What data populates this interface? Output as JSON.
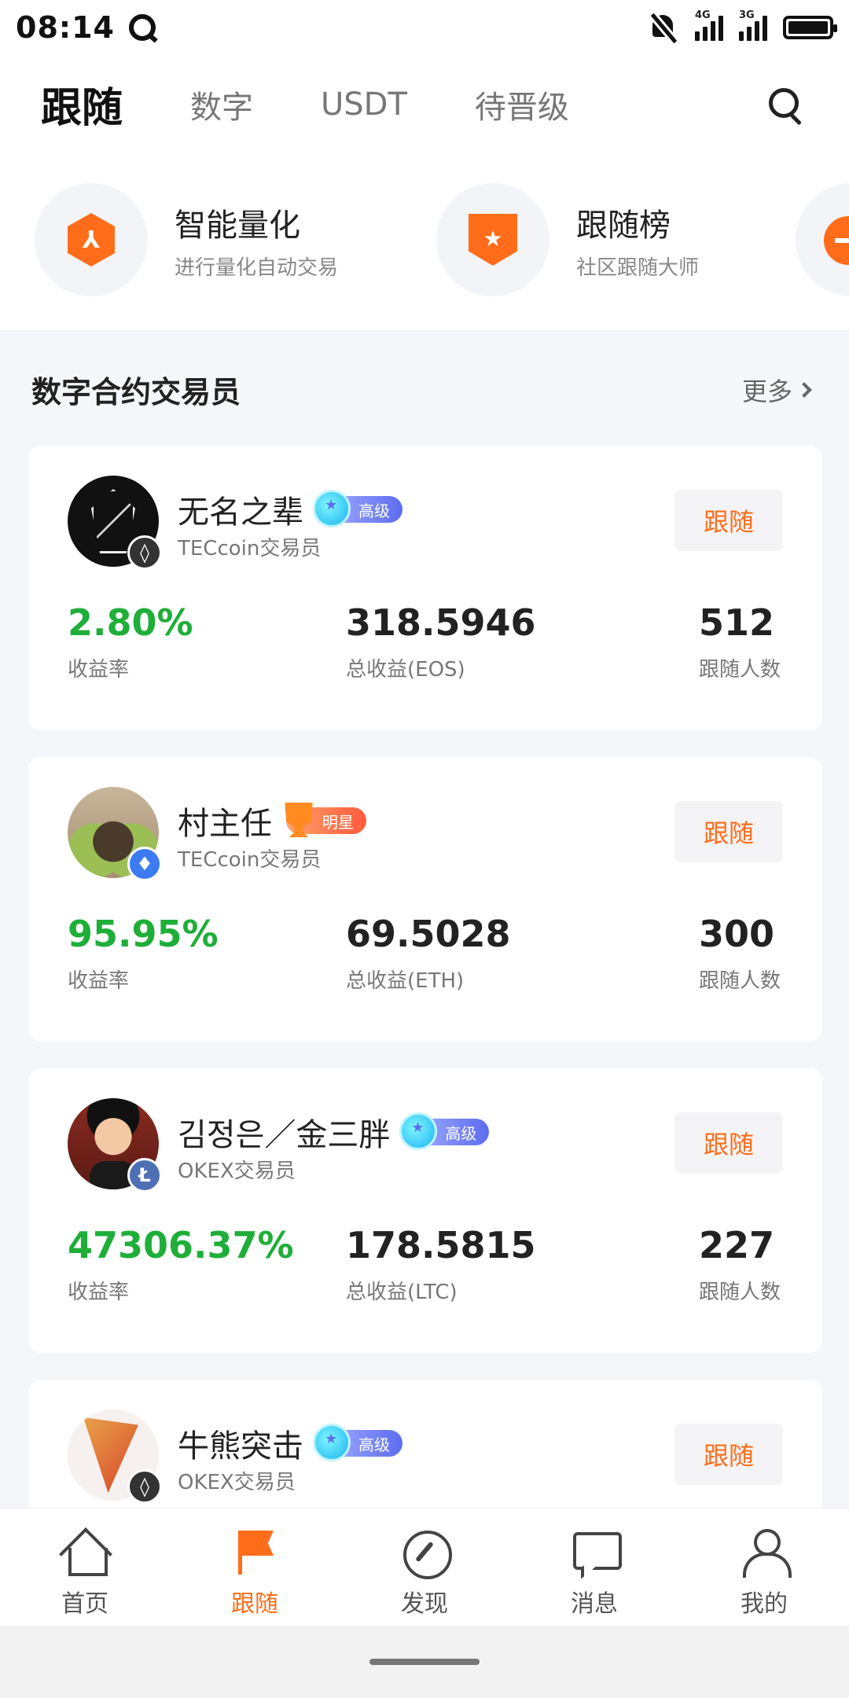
{
  "status_bar": {
    "time": "08:14",
    "icons": [
      "app-q-icon",
      "mute-icon",
      "signal-4g-icon",
      "signal-3g-icon",
      "battery-icon"
    ],
    "net1": "4G",
    "net2": "3G"
  },
  "tabs": [
    {
      "label": "跟随",
      "active": true
    },
    {
      "label": "数字",
      "active": false
    },
    {
      "label": "USDT",
      "active": false
    },
    {
      "label": "待晋级",
      "active": false
    }
  ],
  "features": [
    {
      "title": "智能量化",
      "subtitle": "进行量化自动交易",
      "icon": "quant-hexagon-icon"
    },
    {
      "title": "跟随榜",
      "subtitle": "社区跟随大师",
      "icon": "leaderboard-shield-icon"
    }
  ],
  "section": {
    "title": "数字合约交易员",
    "more": "更多"
  },
  "traders": [
    {
      "name": "无名之辈",
      "badge": "高级",
      "exchange": "TECcoin交易员",
      "follow": "跟随",
      "yield": "2.80%",
      "yield_label": "收益率",
      "profit": "318.5946",
      "profit_label": "总收益(EOS)",
      "followers": "512",
      "followers_label": "跟随人数"
    },
    {
      "name": "村主任",
      "badge": "明星",
      "exchange": "TECcoin交易员",
      "follow": "跟随",
      "yield": "95.95%",
      "yield_label": "收益率",
      "profit": "69.5028",
      "profit_label": "总收益(ETH)",
      "followers": "300",
      "followers_label": "跟随人数"
    },
    {
      "name": "김정은／金三胖",
      "badge": "高级",
      "exchange": "OKEX交易员",
      "follow": "跟随",
      "yield": "47306.37%",
      "yield_label": "收益率",
      "profit": "178.5815",
      "profit_label": "总收益(LTC)",
      "followers": "227",
      "followers_label": "跟随人数"
    },
    {
      "name": "牛熊突击",
      "badge": "高级",
      "exchange": "OKEX交易员",
      "follow": "跟随"
    }
  ],
  "bottom_nav": [
    {
      "label": "首页",
      "icon": "home-icon",
      "active": false
    },
    {
      "label": "跟随",
      "icon": "flag-icon",
      "active": true
    },
    {
      "label": "发现",
      "icon": "compass-icon",
      "active": false
    },
    {
      "label": "消息",
      "icon": "message-icon",
      "active": false
    },
    {
      "label": "我的",
      "icon": "user-icon",
      "active": false
    }
  ],
  "colors": {
    "accent": "#ff6d1a",
    "positive": "#1fae39",
    "badge_senior": "#5c6cf0",
    "badge_star": "#ff5a3c"
  }
}
